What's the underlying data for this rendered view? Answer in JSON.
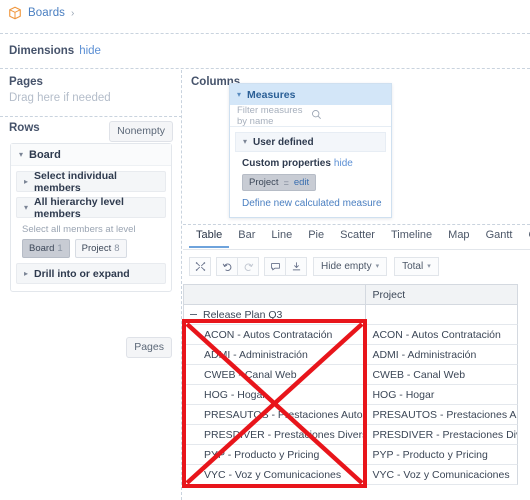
{
  "breadcrumb": {
    "icon": "cube-icon",
    "label": "Boards",
    "separator": "›"
  },
  "dimensions_bar": {
    "label": "Dimensions",
    "hide_label": "hide"
  },
  "pages_zone": {
    "title": "Pages",
    "hint": "Drag here if needed"
  },
  "rows_zone": {
    "title": "Rows",
    "nonempty_label": "Nonempty",
    "pages_button_label": "Pages",
    "board_card": {
      "title": "Board",
      "sections": [
        {
          "label": "Select individual members",
          "expanded": false
        },
        {
          "label": "All hierarchy level members",
          "expanded": true
        },
        {
          "label": "Drill into or expand",
          "expanded": false
        }
      ],
      "level_hint": "Select all members at level",
      "chips": [
        {
          "label": "Board",
          "count": "1",
          "selected": true
        },
        {
          "label": "Project",
          "count": "8",
          "selected": false
        }
      ]
    }
  },
  "columns_zone": {
    "title": "Columns",
    "measures_popup": {
      "title": "Measures",
      "filter_placeholder": "Filter measures by name",
      "search_icon": "search-icon",
      "user_defined_label": "User defined",
      "custom_properties_label": "Custom properties",
      "custom_properties_hide": "hide",
      "property_chip": {
        "name": "Project",
        "operator": "=",
        "edit_label": "edit"
      },
      "define_link": "Define new calculated measure"
    }
  },
  "chart_tabs": [
    {
      "label": "Table",
      "active": true
    },
    {
      "label": "Bar",
      "active": false
    },
    {
      "label": "Line",
      "active": false
    },
    {
      "label": "Pie",
      "active": false
    },
    {
      "label": "Scatter",
      "active": false
    },
    {
      "label": "Timeline",
      "active": false
    },
    {
      "label": "Map",
      "active": false
    },
    {
      "label": "Gantt",
      "active": false
    },
    {
      "label": "Gauge",
      "active": false
    }
  ],
  "toolbar": {
    "icons": [
      {
        "name": "swap-axes-icon",
        "disabled": false
      },
      {
        "name": "undo-icon",
        "disabled": false
      },
      {
        "name": "redo-icon",
        "disabled": true
      },
      {
        "name": "comment-icon",
        "disabled": false
      },
      {
        "name": "export-icon",
        "disabled": false
      }
    ],
    "hide_empty_label": "Hide empty",
    "total_label": "Total",
    "chevron": "▾"
  },
  "pivot_table": {
    "row_header_blank": "",
    "column_header": "Project",
    "group_row": {
      "label": "Release Plan Q3",
      "toggle": "minus",
      "value": ""
    },
    "rows": [
      {
        "header": "ACON - Autos Contratación",
        "value": "ACON - Autos Contratación"
      },
      {
        "header": "ADMI - Administración",
        "value": "ADMI - Administración"
      },
      {
        "header": "CWEB - Canal Web",
        "value": "CWEB - Canal Web"
      },
      {
        "header": "HOG - Hogar",
        "value": "HOG - Hogar"
      },
      {
        "header": "PRESAUTOS - Prestaciones Autos",
        "value": "PRESAUTOS - Prestaciones Autos"
      },
      {
        "header": "PRESDIVER - Prestaciones Diversos",
        "value": "PRESDIVER - Prestaciones Diversos"
      },
      {
        "header": "PYP - Producto y Pricing",
        "value": "PYP - Producto y Pricing"
      },
      {
        "header": "VYC - Voz y Comunicaciones",
        "value": "VYC - Voz y Comunicaciones"
      }
    ]
  },
  "annotation": {
    "type": "red-cross-out",
    "color": "#e8151b",
    "target": "row-header-column"
  },
  "colors": {
    "link_blue": "#4a7fc1",
    "accent_orange": "#f0963c",
    "measures_header_bg": "#d3e6f8",
    "annotation_red": "#e8151b"
  }
}
